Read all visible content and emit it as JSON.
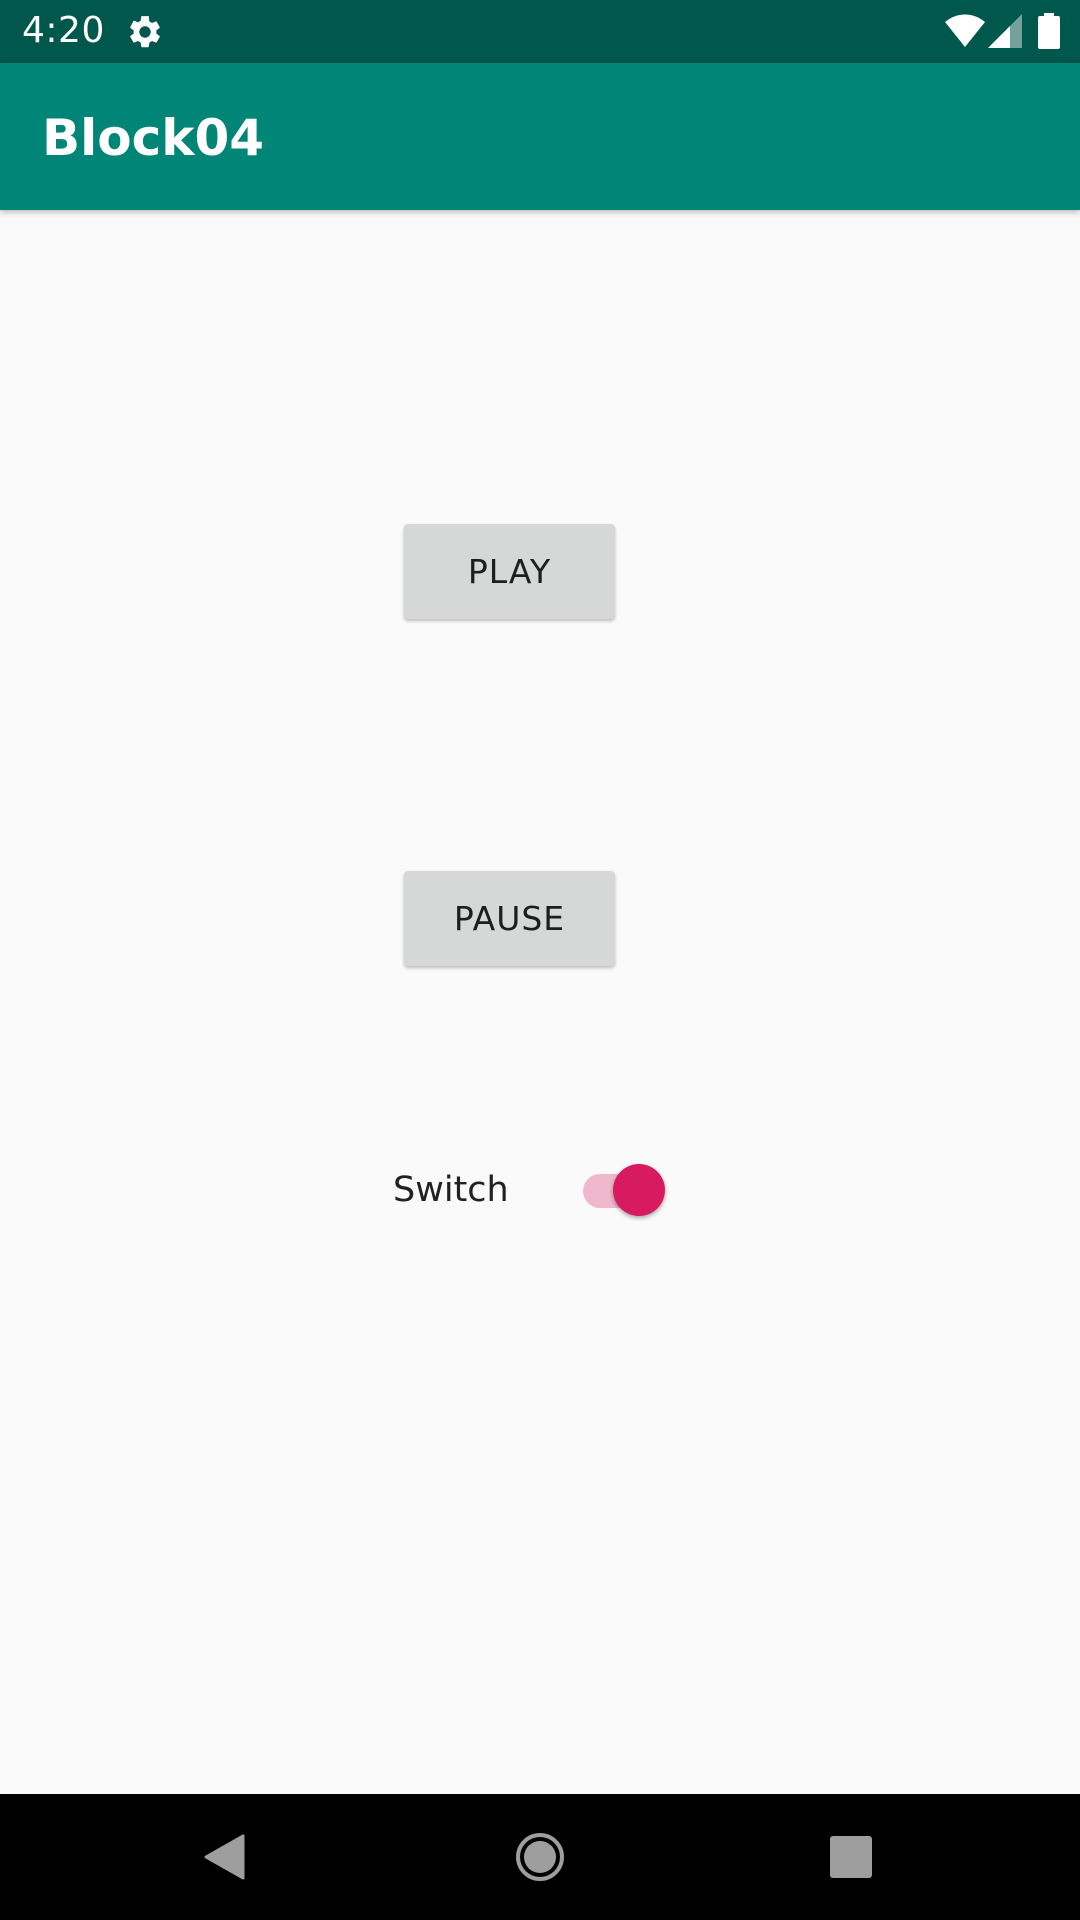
{
  "status_bar": {
    "time": "4:20",
    "icons": [
      "settings-gear-icon",
      "wifi-icon",
      "cell-signal-icon",
      "battery-icon"
    ]
  },
  "app_bar": {
    "title": "Block04"
  },
  "main": {
    "play_label": "PLAY",
    "pause_label": "PAUSE",
    "switch_label": "Switch",
    "switch_on": true
  },
  "nav_bar": {
    "icons": [
      "back-icon",
      "home-icon",
      "recents-icon"
    ]
  },
  "colors": {
    "status_bar": "#00574b",
    "app_bar": "#008577",
    "accent": "#d81b60",
    "button": "#d6d7d7",
    "background": "#fafafa"
  }
}
